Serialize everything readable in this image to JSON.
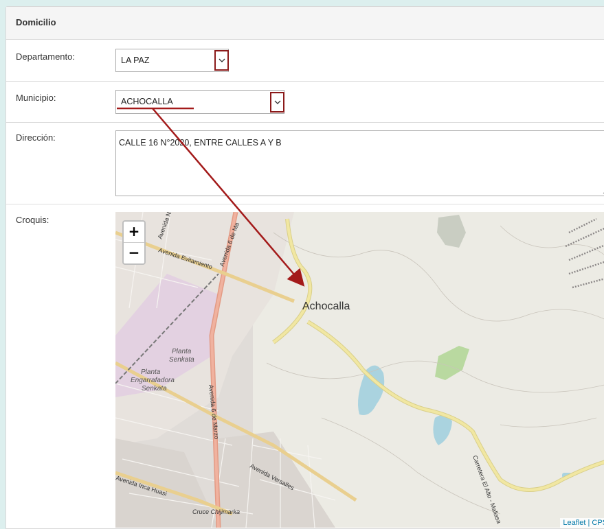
{
  "section": {
    "title": "Domicilio"
  },
  "fields": {
    "departamento": {
      "label": "Departamento:",
      "value": "LA PAZ"
    },
    "municipio": {
      "label": "Municipio:",
      "value": "ACHOCALLA"
    },
    "direccion": {
      "label": "Dirección:",
      "value": "CALLE 16 N°2020, ENTRE CALLES A Y B"
    },
    "croquis": {
      "label": "Croquis:"
    }
  },
  "map": {
    "zoom_in": "+",
    "zoom_out": "−",
    "place_label": "Achocalla",
    "streets": {
      "avenida_evitamiento": "Avenida Evitamiento",
      "avenida_6_de_marzo": "Avenida 6 de Marzo",
      "avenida_6_de_marzo_top": "Avenida 6 de Ma",
      "avenida_n": "Avenida Ne",
      "avenida_versalles": "Avenida Versalles",
      "avenida_inca_huasi": "Avenida Inca Huasi",
      "carretera": "Carretera El Alto - Mallasa",
      "cruce": "Cruce Chijimarka"
    },
    "pois": {
      "planta_senkata_1": "Planta",
      "planta_senkata_2": "Senkata",
      "planta_eng_1": "Planta",
      "planta_eng_2": "Engarrafadora",
      "planta_eng_3": "Senkata"
    },
    "attribution": "Leaflet | CPS"
  },
  "colors": {
    "annotation": "#8b1a1a",
    "primary_road": "#e8927c",
    "secondary_road": "#f2e3a0",
    "water": "#aad3df",
    "park": "#c8dfa8"
  }
}
